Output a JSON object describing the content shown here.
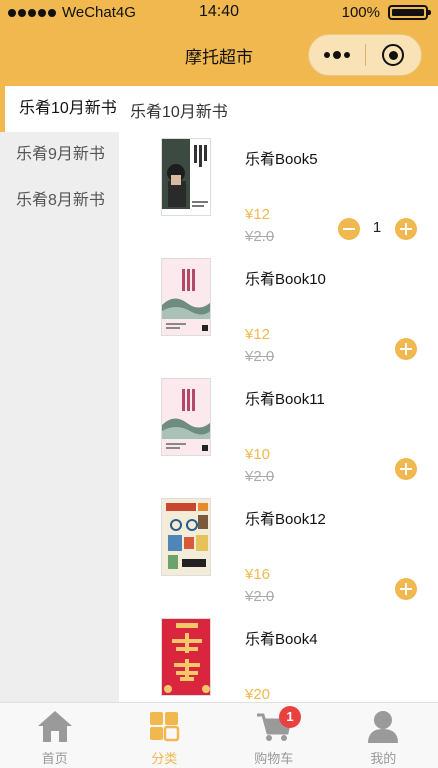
{
  "status_bar": {
    "carrier": "WeChat4G",
    "time": "14:40",
    "battery": "100%"
  },
  "nav": {
    "title": "摩托超市"
  },
  "sidebar": {
    "items": [
      {
        "label": "乐肴10月新书",
        "active": true
      },
      {
        "label": "乐肴9月新书",
        "active": false
      },
      {
        "label": "乐肴8月新书",
        "active": false
      }
    ]
  },
  "section": {
    "title": "乐肴10月新书"
  },
  "products": [
    {
      "name": "乐肴Book5",
      "price": "¥12",
      "old_price": "¥2.0",
      "quantity": "1",
      "cover": "portrait"
    },
    {
      "name": "乐肴Book10",
      "price": "¥12",
      "old_price": "¥2.0",
      "cover": "pink"
    },
    {
      "name": "乐肴Book11",
      "price": "¥10",
      "old_price": "¥2.0",
      "cover": "pink"
    },
    {
      "name": "乐肴Book12",
      "price": "¥16",
      "old_price": "¥2.0",
      "cover": "collage"
    },
    {
      "name": "乐肴Book4",
      "price": "¥20",
      "old_price": "",
      "cover": "red"
    }
  ],
  "tabbar": {
    "items": [
      {
        "label": "首页",
        "icon": "home-icon",
        "active": false
      },
      {
        "label": "分类",
        "icon": "category-icon",
        "active": true
      },
      {
        "label": "购物车",
        "icon": "cart-icon",
        "active": false,
        "badge": "1"
      },
      {
        "label": "我的",
        "icon": "user-icon",
        "active": false
      }
    ]
  },
  "colors": {
    "accent": "#f0b84e",
    "badge": "#e94040",
    "sidebar_bg": "#eeeeee"
  }
}
